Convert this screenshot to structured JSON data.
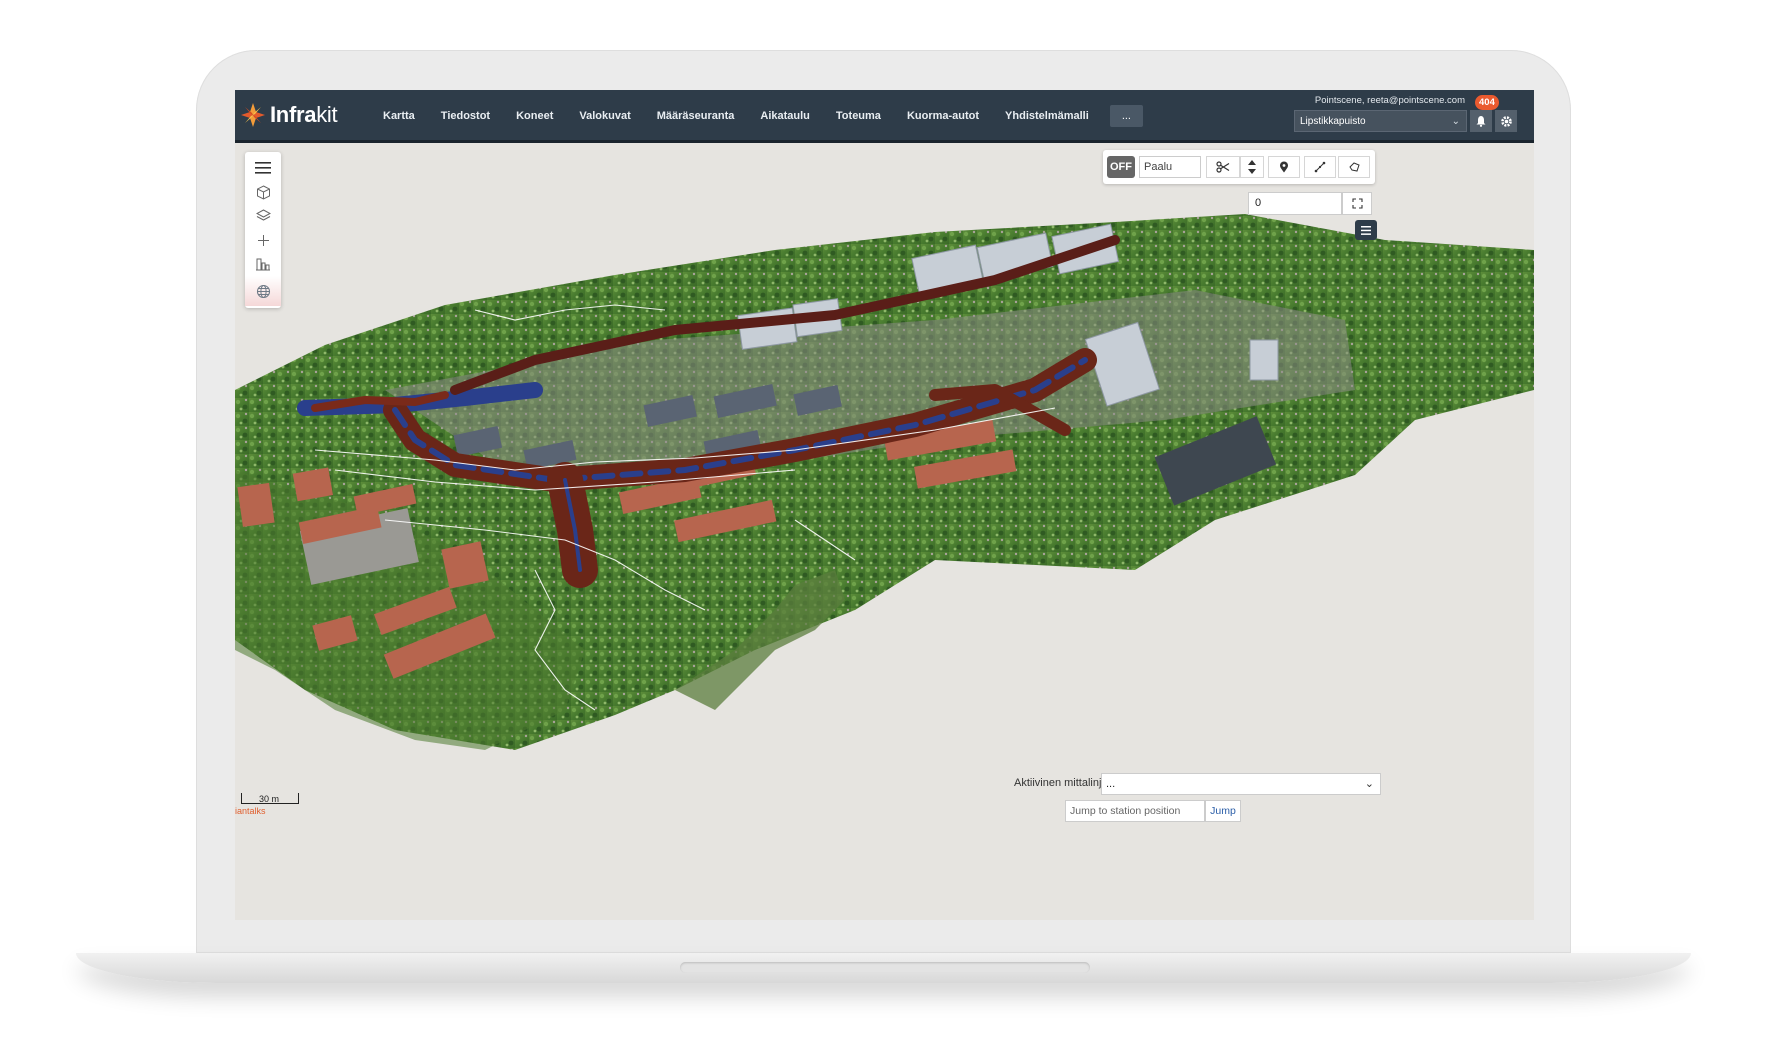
{
  "app": {
    "logo_text_bold": "Infra",
    "logo_text_light": "kit"
  },
  "nav": [
    {
      "label": "Kartta"
    },
    {
      "label": "Tiedostot"
    },
    {
      "label": "Koneet"
    },
    {
      "label": "Valokuvat"
    },
    {
      "label": "Määräseuranta"
    },
    {
      "label": "Aikataulu"
    },
    {
      "label": "Toteuma"
    },
    {
      "label": "Kuorma-autot"
    },
    {
      "label": "Yhdistelmämalli"
    }
  ],
  "nav_more": "...",
  "user": {
    "line": "Pointscene, reeta@pointscene.com"
  },
  "project": {
    "selected": "Lipstikkapuisto"
  },
  "notifications": {
    "count": "404"
  },
  "left_toolbar": [
    {
      "icon": "menu-icon"
    },
    {
      "icon": "cube-icon"
    },
    {
      "icon": "layers-icon"
    },
    {
      "icon": "crosshair-icon"
    },
    {
      "icon": "buildings-icon"
    },
    {
      "icon": "globe-icon"
    }
  ],
  "tools": {
    "toggle_label": "OFF",
    "paalu_placeholder": "Paalu",
    "icons": [
      "scissors-icon",
      "up-down-icon",
      "pin-icon",
      "measure-line-icon",
      "measure-area-icon"
    ]
  },
  "zoom": {
    "value": "0"
  },
  "active_line": {
    "label": "Aktiivinen mittalinja:",
    "selected": "..."
  },
  "jump": {
    "placeholder": "Jump to station position",
    "button": "Jump"
  },
  "scale": {
    "label": "30 m"
  },
  "attribution": "iantalks",
  "colors": {
    "topbar": "#2e3c49",
    "badge": "#ea5a2f",
    "accent_orange": "#ea5a2f"
  }
}
